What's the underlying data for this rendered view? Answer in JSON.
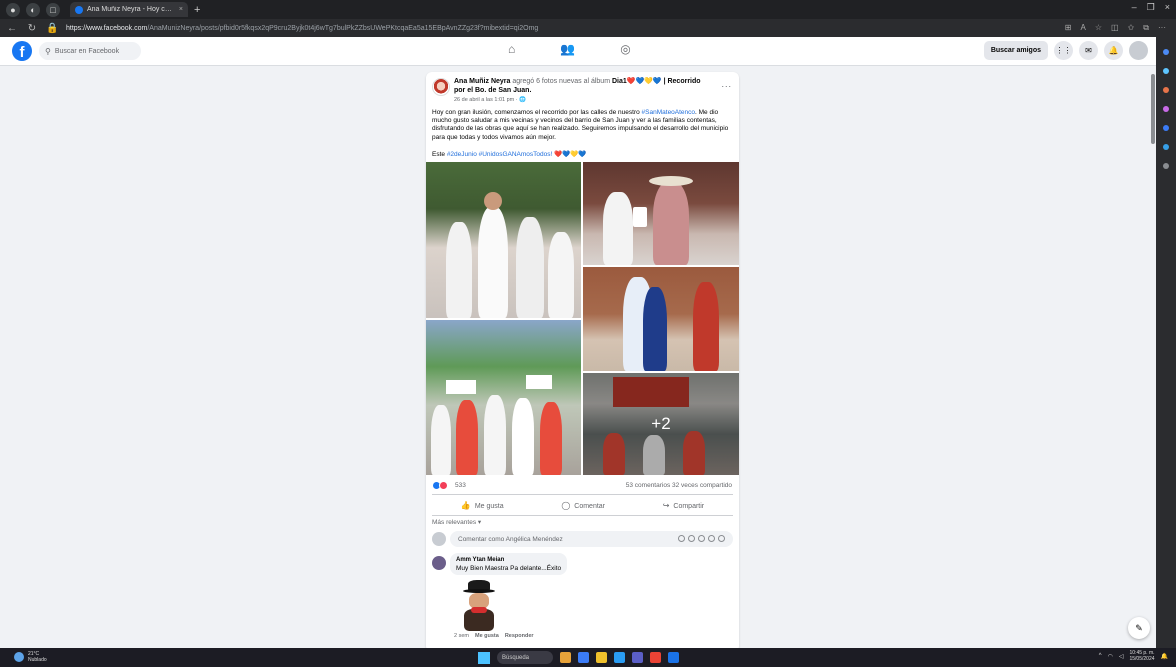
{
  "browser": {
    "tab_title": "Ana Muñiz Neyra - Hoy con gran",
    "url_host": "https://www.facebook.com",
    "url_path": "/AnaMunizNeyra/posts/pfbid0r5fkqsx2qP9cru2Byjk0t4j6wTg7bulPkZZbsUWePKtcqaEa5a15EBpAvnZZg23f?mibextid=qi2Omg"
  },
  "fb": {
    "search_placeholder": "Buscar en Facebook",
    "find_friends": "Buscar amigos"
  },
  "post": {
    "author": "Ana Muñiz Neyra",
    "action": " agregó 6 fotos nuevas al álbum ",
    "album": "Dia1❤️💙💛💙 | Recorrido por el Bo. de San Juan.",
    "date": "26 de abril a las 1:01 pm · 🌐",
    "more": "...",
    "text_before": "Hoy con gran ilusión, comenzamos el recorrido por las calles de nuestro ",
    "text_tag": "#SanMateoAtenco",
    "text_after": ". Me dio mucho gusto saludar a mis vecinas y vecinos del barrio de San Juan y ver a las familias contentas, disfrutando de las obras que aquí se han realizado. Seguiremos impulsando el desarrollo del municipio para que todas y todos vivamos aún mejor.",
    "hashtags_prefix": "Este ",
    "hashtags": "#2deJunio #UnidosGANAmosTodos!",
    "hashtags_suffix": " ❤️💙💛💙",
    "more_photos": "+2",
    "reaction_count": "533",
    "comments_shares": "53 comentarios  32 veces compartido",
    "like": "Me gusta",
    "comment": "Comentar",
    "share": "Compartir",
    "sort": "Más relevantes ▾",
    "comment_placeholder": "Comentar como Angélica Menéndez"
  },
  "comment": {
    "name": "Amm Ytan Meian",
    "text": "Muy Bien Maestra Pa delante...Éxito",
    "time": "2 sem",
    "like": "Me gusta",
    "reply": "Responder"
  },
  "taskbar": {
    "temp": "21°C",
    "weather": "Nublado",
    "search": "Búsqueda",
    "time": "10:45 p. m.",
    "date": "15/05/2024"
  },
  "colors": {
    "fb_blue": "#1877f2",
    "hashtag": "#216fdb",
    "page_bg": "#f0f2f5"
  }
}
